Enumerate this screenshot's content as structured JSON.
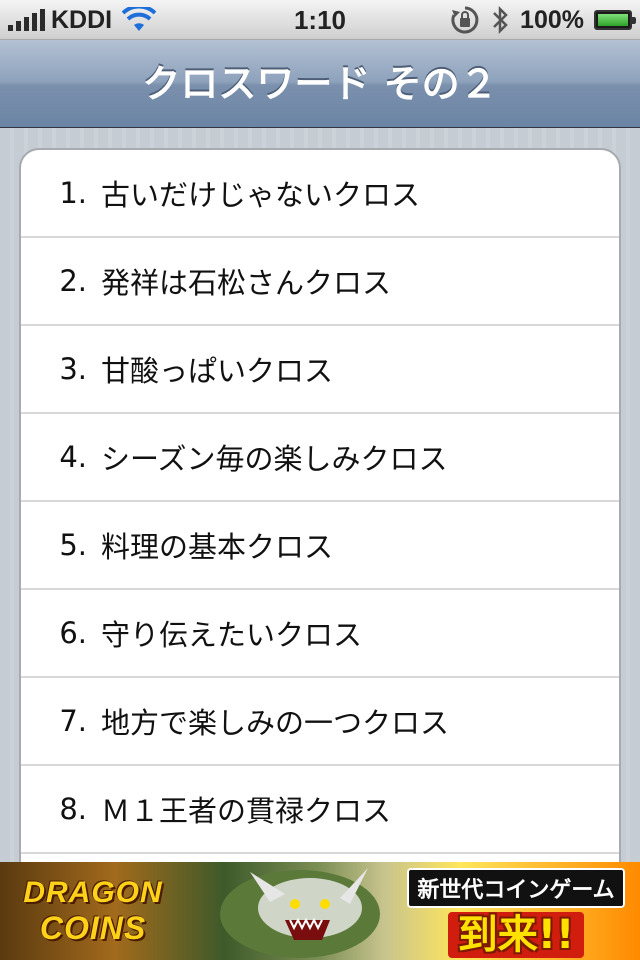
{
  "status_bar": {
    "carrier": "KDDI",
    "time": "1:10",
    "battery_percent": "100%",
    "signal_bars": 5,
    "icons": [
      "signal-bars-icon",
      "wifi-icon",
      "orientation-lock-icon",
      "bluetooth-icon",
      "battery-icon"
    ]
  },
  "nav": {
    "title": "クロスワード その２"
  },
  "list": {
    "items": [
      {
        "num": "1.",
        "label": "古いだけじゃないクロス"
      },
      {
        "num": "2.",
        "label": "発祥は石松さんクロス"
      },
      {
        "num": "3.",
        "label": "甘酸っぱいクロス"
      },
      {
        "num": "4.",
        "label": "シーズン毎の楽しみクロス"
      },
      {
        "num": "5.",
        "label": "料理の基本クロス"
      },
      {
        "num": "6.",
        "label": "守り伝えたいクロス"
      },
      {
        "num": "7.",
        "label": "地方で楽しみの一つクロス"
      },
      {
        "num": "8.",
        "label": "Ｍ１王者の貫禄クロス"
      }
    ]
  },
  "ad": {
    "logo_line1": "DRAGON",
    "logo_line2": "COINS",
    "tagline": "新世代コインゲーム",
    "headline": "到来!!",
    "colors": {
      "accent_yellow": "#ffe100",
      "accent_red": "#d11d0e"
    }
  }
}
